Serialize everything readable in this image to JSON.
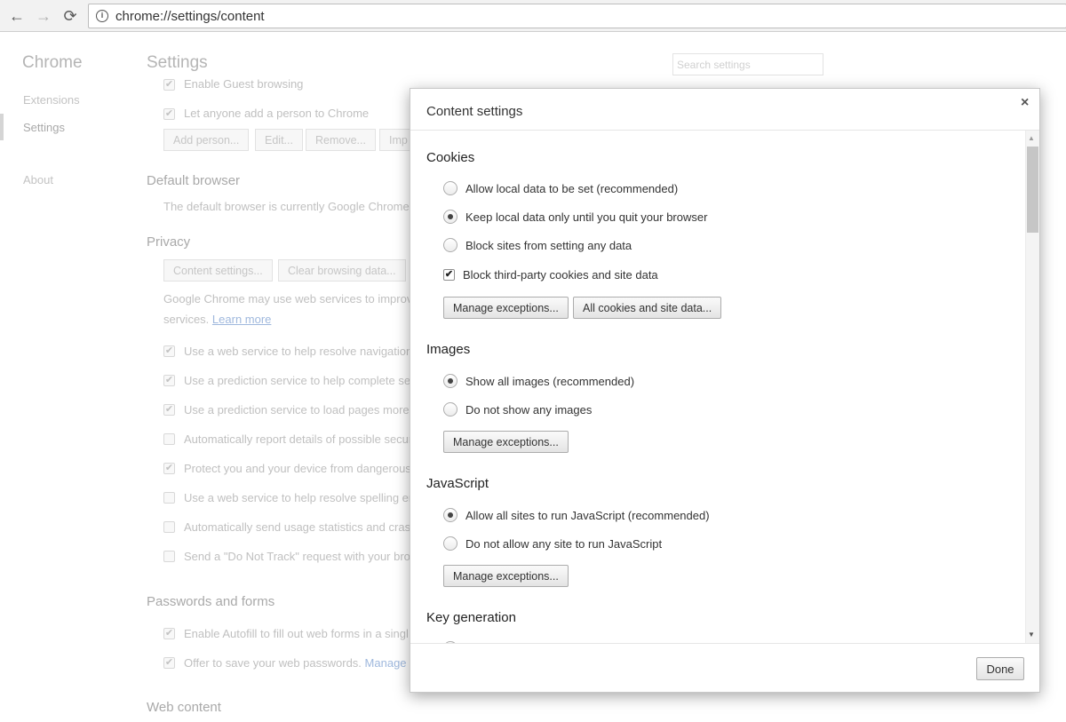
{
  "toolbar": {
    "back_icon": "←",
    "forward_icon": "→",
    "reload_icon": "⟳",
    "info_icon": "i",
    "url": "chrome://settings/content"
  },
  "sidebar": {
    "title": "Chrome",
    "items": [
      "Extensions",
      "Settings",
      "About"
    ]
  },
  "main": {
    "title": "Settings",
    "search_placeholder": "Search settings",
    "people": {
      "guest_label": "Enable Guest browsing",
      "add_person_label": "Let anyone add a person to Chrome",
      "buttons": [
        "Add person...",
        "Edit...",
        "Remove...",
        "Imp"
      ]
    },
    "default_browser": {
      "heading": "Default browser",
      "text": "The default browser is currently Google Chrome."
    },
    "privacy": {
      "heading": "Privacy",
      "buttons": [
        "Content settings...",
        "Clear browsing data..."
      ],
      "desc_line1": "Google Chrome may use web services to improve",
      "desc_line2_prefix": "services.",
      "learn_more": "Learn more",
      "options": [
        {
          "label": "Use a web service to help resolve navigation e",
          "checked": true
        },
        {
          "label": "Use a prediction service to help complete sea",
          "checked": true
        },
        {
          "label": "Use a prediction service to load pages more q",
          "checked": true
        },
        {
          "label": "Automatically report details of possible secur",
          "checked": false
        },
        {
          "label": "Protect you and your device from dangerous",
          "checked": true
        },
        {
          "label": "Use a web service to help resolve spelling erro",
          "checked": false
        },
        {
          "label": "Automatically send usage statistics and crash",
          "checked": false
        },
        {
          "label": "Send a \"Do Not Track\" request with your brov",
          "checked": false
        }
      ]
    },
    "passwords": {
      "heading": "Passwords and forms",
      "autofill_label": "Enable Autofill to fill out web forms in a singl",
      "save_passwords_label": "Offer to save your web passwords.",
      "manage_link": "Manage p"
    },
    "web_content": {
      "heading": "Web content"
    }
  },
  "dialog": {
    "title": "Content settings",
    "close_icon": "×",
    "cookies": {
      "heading": "Cookies",
      "options": [
        {
          "label": "Allow local data to be set (recommended)",
          "selected": false
        },
        {
          "label": "Keep local data only until you quit your browser",
          "selected": true
        },
        {
          "label": "Block sites from setting any data",
          "selected": false
        }
      ],
      "block_third_party_label": "Block third-party cookies and site data",
      "block_third_party_checked": true,
      "manage_button": "Manage exceptions...",
      "all_cookies_button": "All cookies and site data..."
    },
    "images": {
      "heading": "Images",
      "options": [
        {
          "label": "Show all images (recommended)",
          "selected": true
        },
        {
          "label": "Do not show any images",
          "selected": false
        }
      ],
      "manage_button": "Manage exceptions..."
    },
    "javascript": {
      "heading": "JavaScript",
      "options": [
        {
          "label": "Allow all sites to run JavaScript (recommended)",
          "selected": true
        },
        {
          "label": "Do not allow any site to run JavaScript",
          "selected": false
        }
      ],
      "manage_button": "Manage exceptions..."
    },
    "key_generation": {
      "heading": "Key generation"
    },
    "done_button": "Done"
  }
}
